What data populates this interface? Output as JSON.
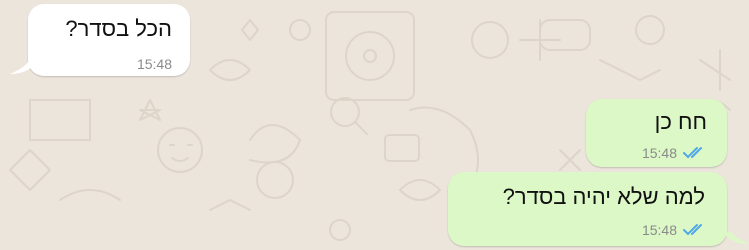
{
  "chat": {
    "messages": [
      {
        "direction": "incoming",
        "text": "הכל בסדר?",
        "time": "15:48",
        "status": ""
      },
      {
        "direction": "outgoing",
        "text": "חח כן",
        "time": "15:48",
        "status": "read"
      },
      {
        "direction": "outgoing",
        "text": "למה שלא יהיה בסדר?",
        "time": "15:48",
        "status": "read"
      }
    ]
  },
  "colors": {
    "incoming_bubble": "#ffffff",
    "outgoing_bubble": "#dcf8c6",
    "read_ticks": "#4fa8e8",
    "background": "#ece5dc"
  }
}
